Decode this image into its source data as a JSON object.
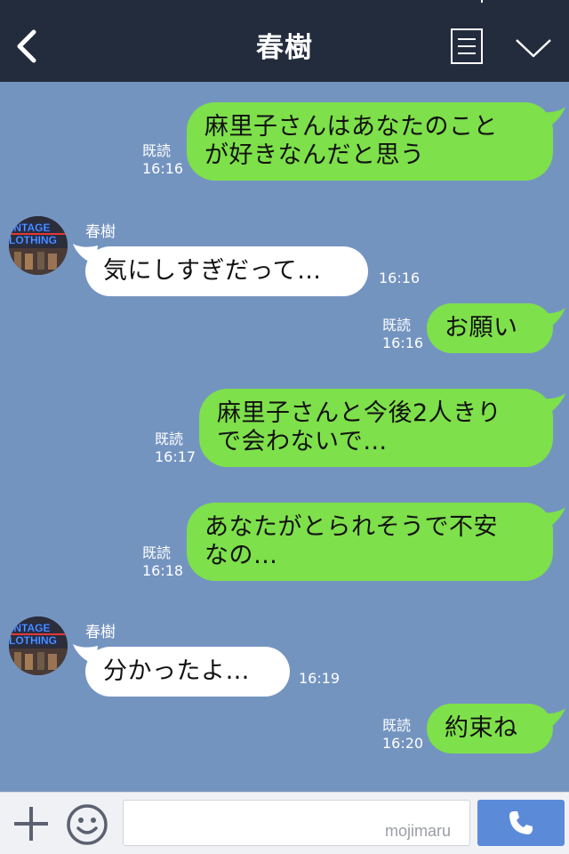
{
  "header": {
    "title": "春樹",
    "back_icon": "chevron-left-icon",
    "menu_icon": "menu-icon",
    "collapse_icon": "chevron-down-icon"
  },
  "messages": [
    {
      "side": "right",
      "text_lines": [
        "麻里子さんはあなたのこと",
        "が好きなんだと思う"
      ],
      "read": "既読",
      "time": "16:16"
    },
    {
      "side": "left",
      "sender": "春樹",
      "text_lines": [
        "気にしすぎだって…"
      ],
      "time": "16:16"
    },
    {
      "side": "right",
      "text_lines": [
        "お願い"
      ],
      "read": "既読",
      "time": "16:16"
    },
    {
      "side": "right",
      "text_lines": [
        "麻里子さんと今後2人きり",
        "で会わないで…"
      ],
      "read": "既読",
      "time": "16:17"
    },
    {
      "side": "right",
      "text_lines": [
        "あなたがとられそうで不安",
        "なの…"
      ],
      "read": "既読",
      "time": "16:18"
    },
    {
      "side": "left",
      "sender": "春樹",
      "text_lines": [
        "分かったよ…"
      ],
      "time": "16:19"
    },
    {
      "side": "right",
      "text_lines": [
        "約束ね"
      ],
      "read": "既読",
      "time": "16:20"
    }
  ],
  "avatar": {
    "text_line1": "INTAGE",
    "text_line2": "LOTHING"
  },
  "input": {
    "value": "",
    "placeholder": ""
  },
  "watermark": "mojimaru",
  "colors": {
    "header_bg": "#232c3d",
    "chat_bg": "#7494c0",
    "bubble_green": "#7ee04a",
    "bubble_white": "#ffffff",
    "call_button": "#5b8ad9"
  }
}
